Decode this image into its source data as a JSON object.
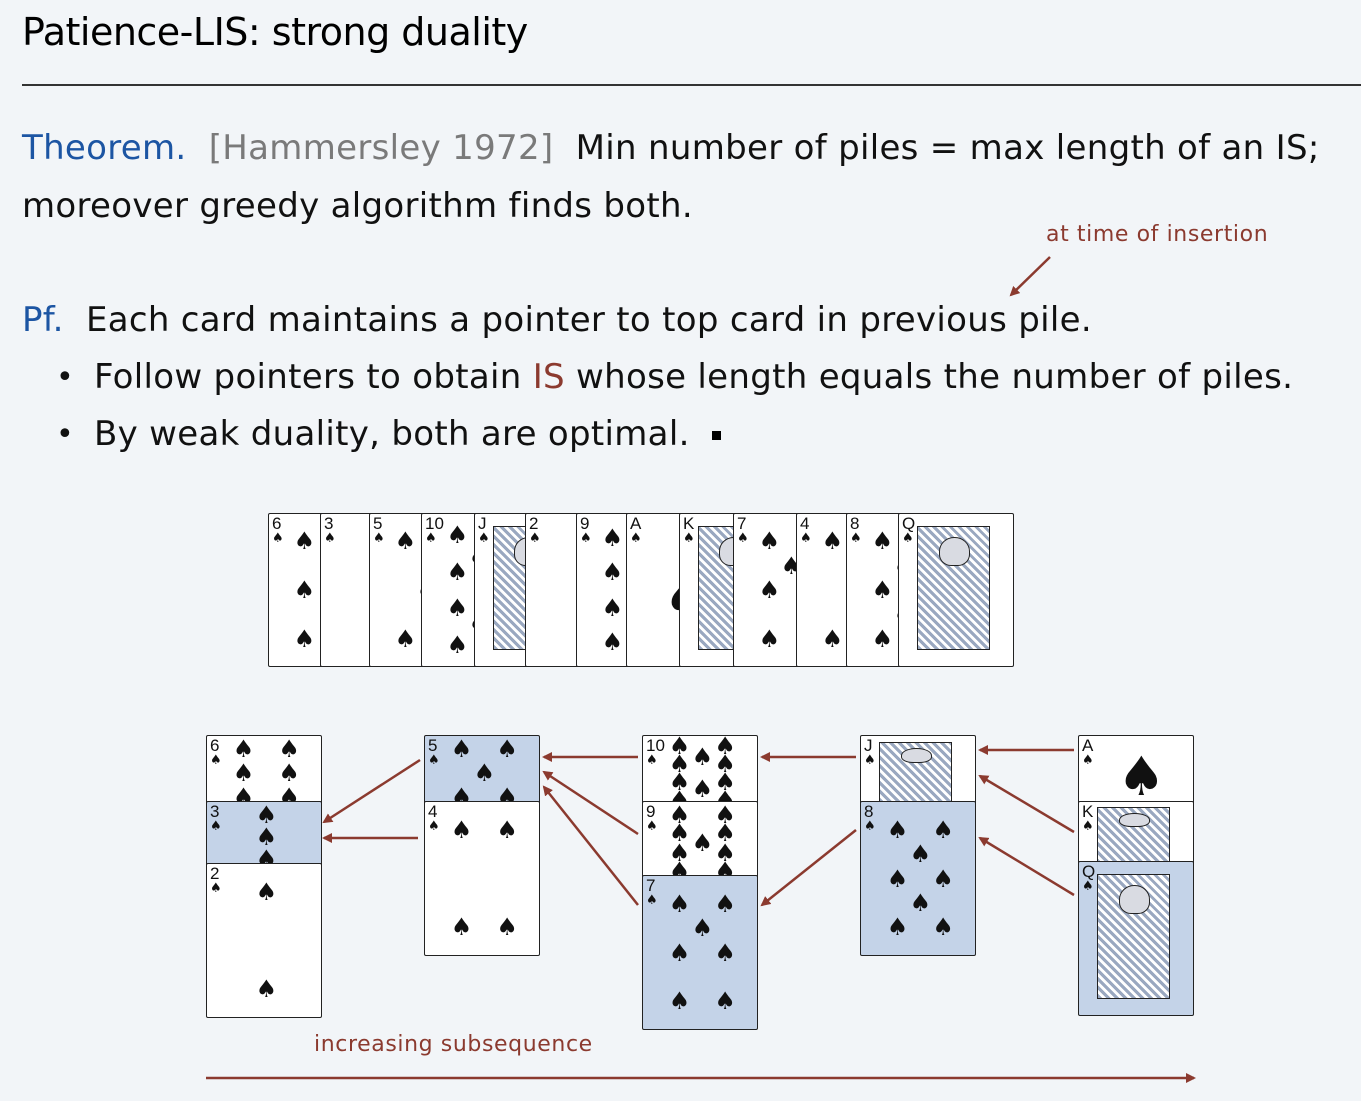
{
  "title": "Patience-LIS:  strong duality",
  "theorem": {
    "label": "Theorem.",
    "citation": "[Hammersley 1972]",
    "line1_rest": "Min number of piles = max length of an IS;",
    "line2": "moreover greedy algorithm finds both."
  },
  "note_insertion": "at time of insertion",
  "proof": {
    "label": "Pf.",
    "text": "Each card maintains a pointer to top card in previous pile."
  },
  "bullets": [
    {
      "before": "Follow pointers to obtain ",
      "highlight": "IS",
      "after": " whose length equals the number of piles."
    },
    {
      "text": "By weak duality, both are optimal."
    }
  ],
  "sequence": [
    "6",
    "3",
    "5",
    "10",
    "J",
    "2",
    "9",
    "A",
    "K",
    "7",
    "4",
    "8",
    "Q"
  ],
  "piles": [
    [
      "6",
      "3",
      "2"
    ],
    [
      "5",
      "4"
    ],
    [
      "10",
      "9",
      "7"
    ],
    [
      "J",
      "8"
    ],
    [
      "A",
      "K",
      "Q"
    ]
  ],
  "highlighted_is": [
    "3",
    "5",
    "7",
    "8",
    "Q"
  ],
  "suit_symbol": "♠",
  "bottom_label": "increasing subsequence",
  "colors": {
    "accent_blue": "#1c55a3",
    "arrow_red": "#8b3a2f",
    "highlight": "#c4d3e8"
  }
}
